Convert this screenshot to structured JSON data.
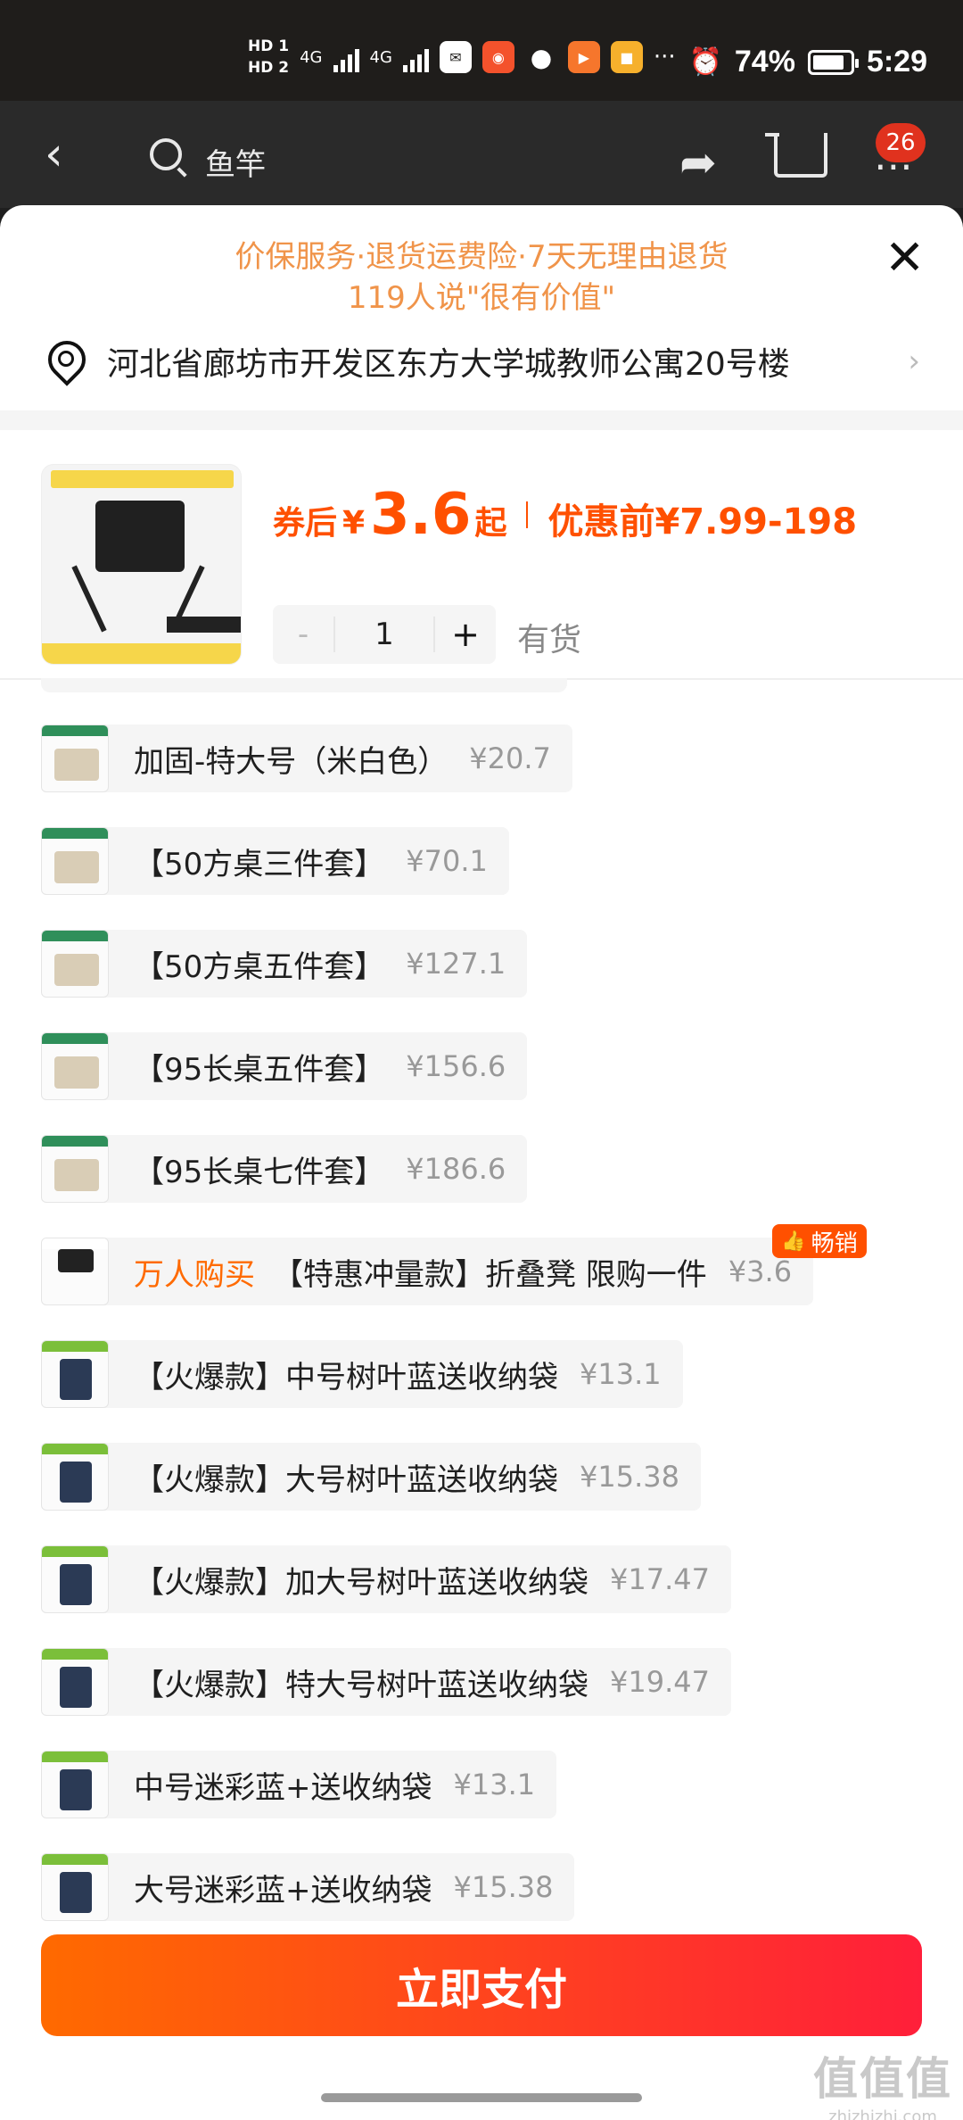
{
  "status": {
    "hd1": "HD 1",
    "hd2": "HD 2",
    "net1": "4G",
    "net2": "4G",
    "battery": "74%",
    "time": "5:29"
  },
  "header": {
    "search_text": "鱼竿",
    "cart_badge": "26"
  },
  "promo": {
    "line1": "价保服务·退货运费险·7天无理由退货",
    "line2": "119人说\"很有价值\""
  },
  "address": "河北省廊坊市开发区东方大学城教师公寓20号楼",
  "product": {
    "coupon_label": "券后",
    "yen": "¥",
    "price": "3.6",
    "qi": "起",
    "before_price": "优惠前¥7.99-198",
    "quantity": "1",
    "minus": "-",
    "plus": "+",
    "stock": "有货"
  },
  "options": [
    {
      "name": "加固-特大号（米白色）",
      "price": "¥20.7"
    },
    {
      "name": "【50方桌三件套】",
      "price": "¥70.1"
    },
    {
      "name": "【50方桌五件套】",
      "price": "¥127.1"
    },
    {
      "name": "【95长桌五件套】",
      "price": "¥156.6"
    },
    {
      "name": "【95长桌七件套】",
      "price": "¥186.6"
    },
    {
      "tag": "万人购买",
      "name": "【特惠冲量款】折叠凳 限购一件",
      "price": "¥3.6",
      "badge": "畅销"
    },
    {
      "name": "【火爆款】中号树叶蓝送收纳袋",
      "price": "¥13.1"
    },
    {
      "name": "【火爆款】大号树叶蓝送收纳袋",
      "price": "¥15.38"
    },
    {
      "name": "【火爆款】加大号树叶蓝送收纳袋",
      "price": "¥17.47"
    },
    {
      "name": "【火爆款】特大号树叶蓝送收纳袋",
      "price": "¥19.47"
    },
    {
      "name": "中号迷彩蓝+送收纳袋",
      "price": "¥13.1"
    },
    {
      "name": "大号迷彩蓝+送收纳袋",
      "price": "¥15.38"
    }
  ],
  "pay_button": "立即支付",
  "watermark": {
    "logo": "值值值",
    "url": "zhizhizhi.com"
  },
  "colors": {
    "accent": "#ff5000",
    "promo": "#f0944a",
    "tag": "#ff6a00"
  }
}
